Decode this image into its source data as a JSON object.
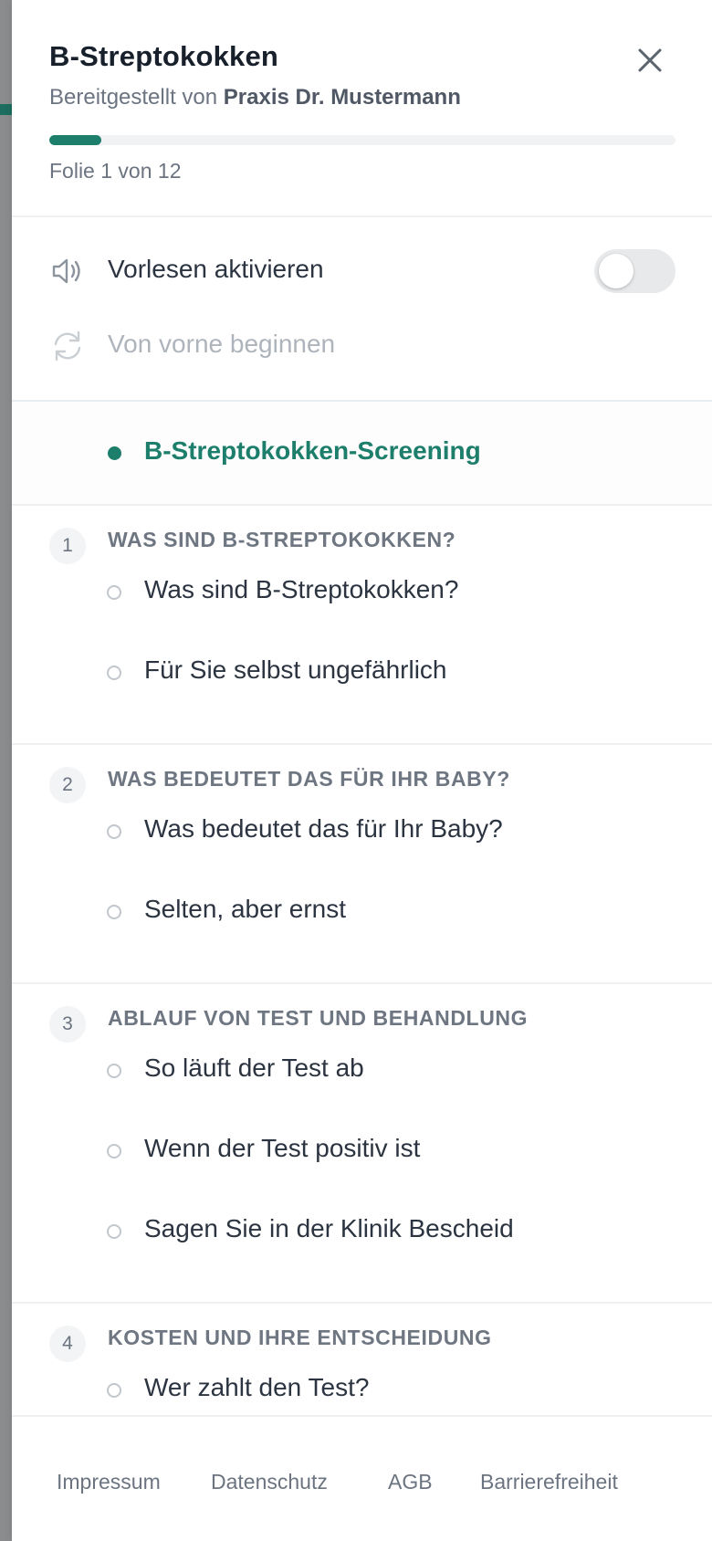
{
  "header": {
    "title": "B-Streptokokken",
    "subtitle_prefix": "Bereitgestellt von ",
    "provider": "Praxis Dr. Mustermann",
    "slide_counter": "Folie 1 von 12",
    "progress_fraction": 0.0833
  },
  "options": {
    "read_aloud_label": "Vorlesen aktivieren",
    "read_aloud_on": false,
    "restart_label": "Von vorne beginnen"
  },
  "slides": {
    "intro": "B-Streptokokken-Screening",
    "sections": [
      {
        "number": "1",
        "title": "WAS SIND B-STREPTOKOKKEN?",
        "items": [
          "Was sind B-Streptokokken?",
          "Für Sie selbst ungefährlich"
        ]
      },
      {
        "number": "2",
        "title": "WAS BEDEUTET DAS FÜR IHR BABY?",
        "items": [
          "Was bedeutet das für Ihr Baby?",
          "Selten, aber ernst"
        ]
      },
      {
        "number": "3",
        "title": "ABLAUF VON TEST UND BEHANDLUNG",
        "items": [
          "So läuft der Test ab",
          "Wenn der Test positiv ist",
          "Sagen Sie in der Klinik Bescheid"
        ]
      },
      {
        "number": "4",
        "title": "KOSTEN UND IHRE ENTSCHEIDUNG",
        "items": [
          "Wer zahlt den Test?"
        ]
      }
    ]
  },
  "footer": {
    "links": [
      "Impressum",
      "Datenschutz",
      "AGB",
      "Barrierefreiheit"
    ]
  },
  "colors": {
    "accent": "#1c7e6b",
    "text": "#2b3440",
    "muted": "#6b7480",
    "disabled": "#aeb4bb"
  },
  "icons": {
    "close": "close-icon",
    "read_aloud": "speaker-icon",
    "restart": "refresh-icon"
  }
}
